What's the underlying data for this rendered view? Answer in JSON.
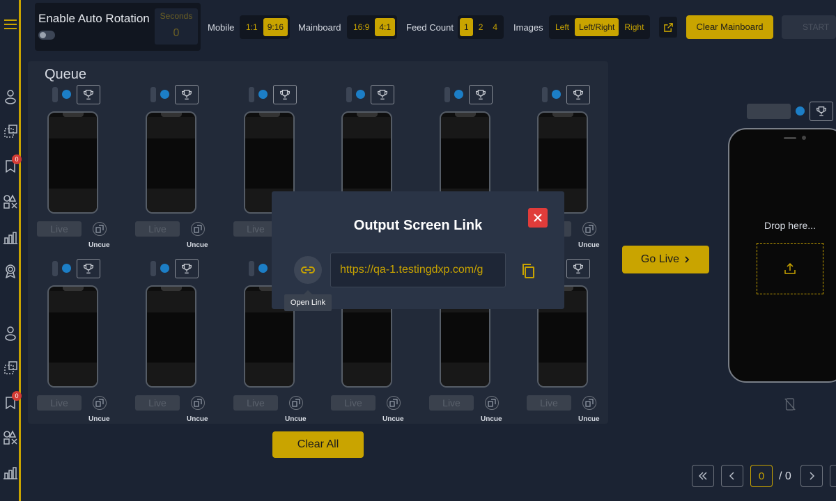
{
  "topbar": {
    "auto_rotation_label": "Enable Auto Rotation",
    "seconds_label": "Seconds",
    "seconds_value": "0",
    "mobile_label": "Mobile",
    "mobile_options": [
      "1:1",
      "9:16"
    ],
    "mobile_selected": "9:16",
    "mainboard_label": "Mainboard",
    "mainboard_options": [
      "16:9",
      "4:1"
    ],
    "mainboard_selected": "4:1",
    "feed_count_label": "Feed Count",
    "feed_count_options": [
      "1",
      "2",
      "4"
    ],
    "feed_count_selected": "1",
    "images_label": "Images",
    "images_options": [
      "Left",
      "Left/Right",
      "Right"
    ],
    "images_selected": "Left/Right",
    "clear_mainboard_label": "Clear Mainboard",
    "start_label": "START"
  },
  "queue": {
    "title": "Queue",
    "live_label": "Live",
    "uncue_label": "Uncue",
    "clear_all_label": "Clear All"
  },
  "preview": {
    "go_live_label": "Go Live",
    "drop_text": "Drop here..."
  },
  "pagination": {
    "current_page": "0",
    "total_text": "/ 0"
  },
  "modal": {
    "title": "Output Screen Link",
    "link_value": "https://qa-1.testingdxp.com/g",
    "tooltip": "Open Link"
  },
  "sidebar": {
    "badge_1": "0",
    "badge_2": "0"
  },
  "colors": {
    "accent": "#c9a400",
    "background": "#1b2333",
    "panel": "#222a39",
    "modal": "#2a3446",
    "close": "#e03c3a",
    "status_dot": "#1c7ec6"
  }
}
